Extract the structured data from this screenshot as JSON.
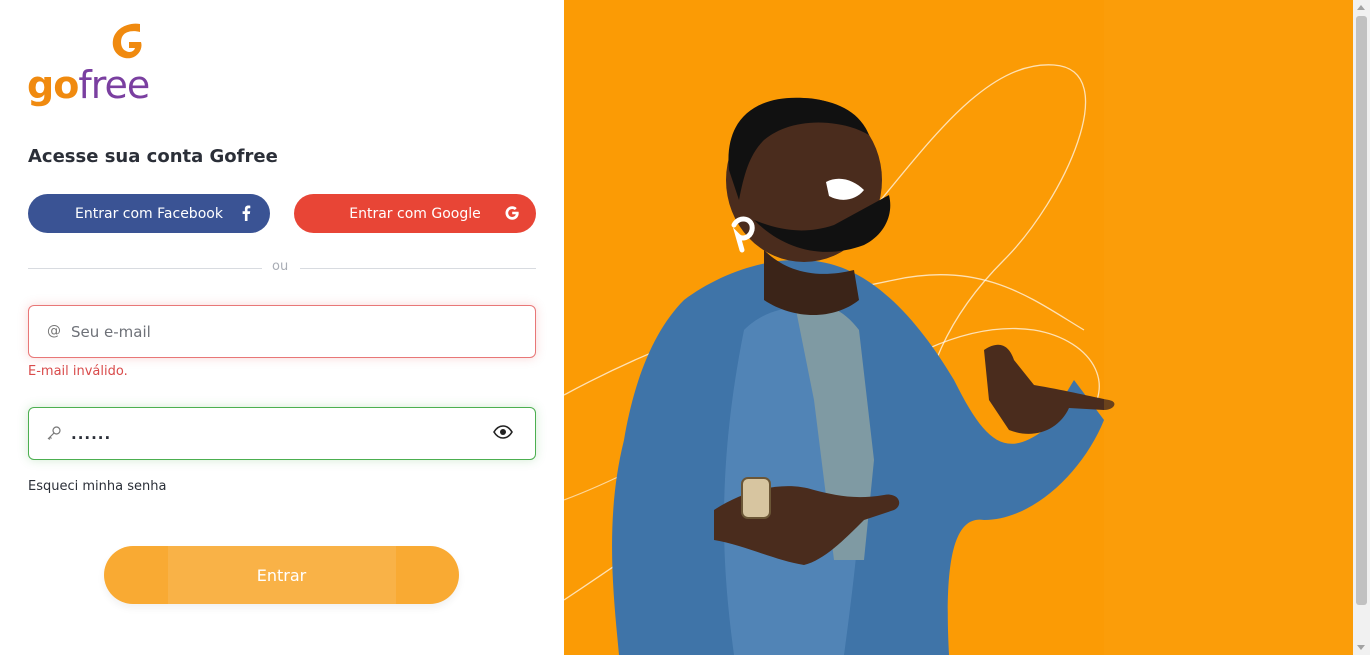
{
  "brand": {
    "part1": "go",
    "part2": "free"
  },
  "heading": "Acesse sua conta Gofree",
  "social": {
    "facebook_label": "Entrar com Facebook",
    "google_label": "Entrar com Google"
  },
  "divider_label": "ou",
  "email": {
    "placeholder": "Seu e-mail",
    "value": "",
    "error": "E-mail inválido."
  },
  "password": {
    "value": "......"
  },
  "forgot_label": "Esqueci minha senha",
  "submit_label": "Entrar",
  "colors": {
    "facebook": "#3a5394",
    "google": "#e84536",
    "accent": "#f9aa33",
    "hero_bg": "#fb9b05",
    "error": "#d94b4b",
    "valid": "#4caf50"
  },
  "icons": [
    "gofree-logo-icon",
    "facebook-icon",
    "google-icon",
    "at-icon",
    "key-icon",
    "eye-icon"
  ]
}
